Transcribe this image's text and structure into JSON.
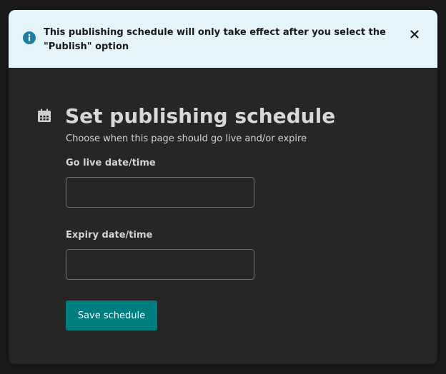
{
  "banner": {
    "message": "This publishing schedule will only take effect after you select the \"Publish\" option",
    "close_label": "Close"
  },
  "heading": {
    "title": "Set publishing schedule",
    "subtitle": "Choose when this page should go live and/or expire"
  },
  "fields": {
    "go_live": {
      "label": "Go live date/time",
      "value": ""
    },
    "expiry": {
      "label": "Expiry date/time",
      "value": ""
    }
  },
  "actions": {
    "save_label": "Save schedule"
  },
  "colors": {
    "banner_bg": "#e3f4fb",
    "info_icon": "#1f7ca3",
    "modal_bg": "#262626",
    "accent": "#007d7e"
  },
  "icons": {
    "banner": "info-circle-icon",
    "close": "close-icon",
    "heading": "calendar-icon"
  }
}
